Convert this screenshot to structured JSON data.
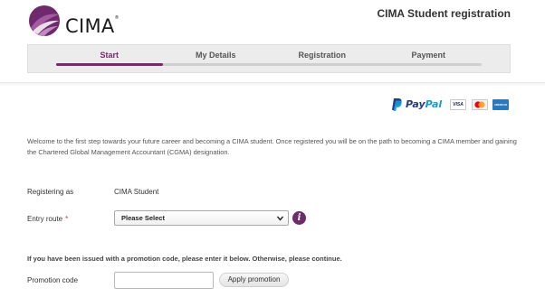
{
  "header": {
    "logo_text": "CIMA",
    "logo_tm": "®",
    "title": "CIMA Student registration"
  },
  "progress": {
    "steps": [
      {
        "label": "Start",
        "active": true
      },
      {
        "label": "My Details",
        "active": false
      },
      {
        "label": "Registration",
        "active": false
      },
      {
        "label": "Payment",
        "active": false
      }
    ],
    "completed_fraction": 0.25,
    "accent_color": "#7a2670"
  },
  "payment": {
    "paypal_pay": "Pay",
    "paypal_pal": "Pal",
    "cards": [
      "visa-logo",
      "mastercard-logo",
      "amex-logo"
    ],
    "visa_text": "VISA",
    "amex_text": "AMERICAN EXPRESS"
  },
  "welcome_text": "Welcome to the first step towards your future career and becoming a CIMA student.  Once registered you will be on the path to becoming a CIMA member and gaining the Chartered Global Management Accountant (CGMA) designation.",
  "form": {
    "registering_as_label": "Registering as",
    "registering_as_value": "CIMA Student",
    "entry_route_label": "Entry route",
    "required_marker": "*",
    "entry_route_selected": "Please Select",
    "info_icon_glyph": "i",
    "promo_note": "If you have been issued with a promotion code, please enter it below. Otherwise, please continue.",
    "promo_label": "Promotion code",
    "promo_value": "",
    "apply_label": "Apply promotion"
  }
}
